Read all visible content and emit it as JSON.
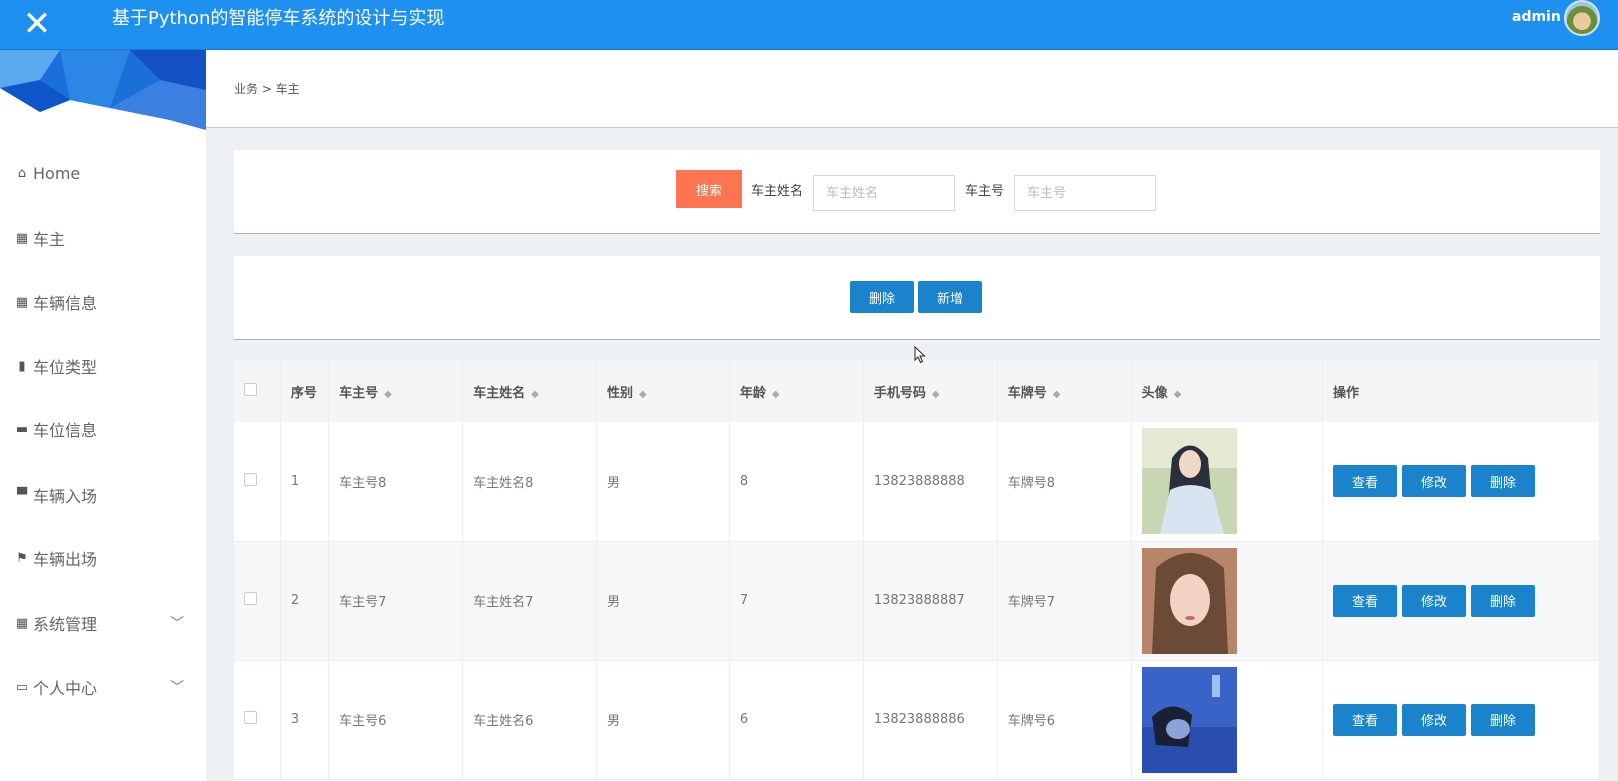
{
  "header": {
    "title": "基于Python的智能停车系统的设计与实现",
    "user": "admin"
  },
  "sidebar": {
    "items": [
      {
        "label": "Home",
        "icon": "home-icon"
      },
      {
        "label": "车主",
        "icon": "grid-icon"
      },
      {
        "label": "车辆信息",
        "icon": "grid-icon"
      },
      {
        "label": "车位类型",
        "icon": "books-icon"
      },
      {
        "label": "车位信息",
        "icon": "wallet-icon"
      },
      {
        "label": "车辆入场",
        "icon": "car-icon"
      },
      {
        "label": "车辆出场",
        "icon": "flag-icon"
      },
      {
        "label": "系统管理",
        "icon": "grid-icon"
      },
      {
        "label": "个人中心",
        "icon": "card-icon"
      }
    ]
  },
  "breadcrumb": "业务 > 车主",
  "search": {
    "button": "搜索",
    "name_label": "车主姓名",
    "name_placeholder": "车主姓名",
    "id_label": "车主号",
    "id_placeholder": "车主号"
  },
  "actions": {
    "delete": "删除",
    "add": "新增"
  },
  "table": {
    "headers": [
      "序号",
      "车主号",
      "车主姓名",
      "性别",
      "年龄",
      "手机号码",
      "车牌号",
      "头像",
      "操作"
    ],
    "rows": [
      {
        "no": "1",
        "owner_id": "车主号8",
        "name": "车主姓名8",
        "gender": "男",
        "age": "8",
        "phone": "13823888888",
        "plate": "车牌号8"
      },
      {
        "no": "2",
        "owner_id": "车主号7",
        "name": "车主姓名7",
        "gender": "男",
        "age": "7",
        "phone": "13823888887",
        "plate": "车牌号7"
      },
      {
        "no": "3",
        "owner_id": "车主号6",
        "name": "车主姓名6",
        "gender": "男",
        "age": "6",
        "phone": "13823888886",
        "plate": "车牌号6"
      }
    ],
    "row_actions": {
      "view": "查看",
      "edit": "修改",
      "delete": "删除"
    }
  },
  "colors": {
    "header": "#1e90f0",
    "search_button": "#ff7451",
    "action_button": "#1a83cc"
  }
}
